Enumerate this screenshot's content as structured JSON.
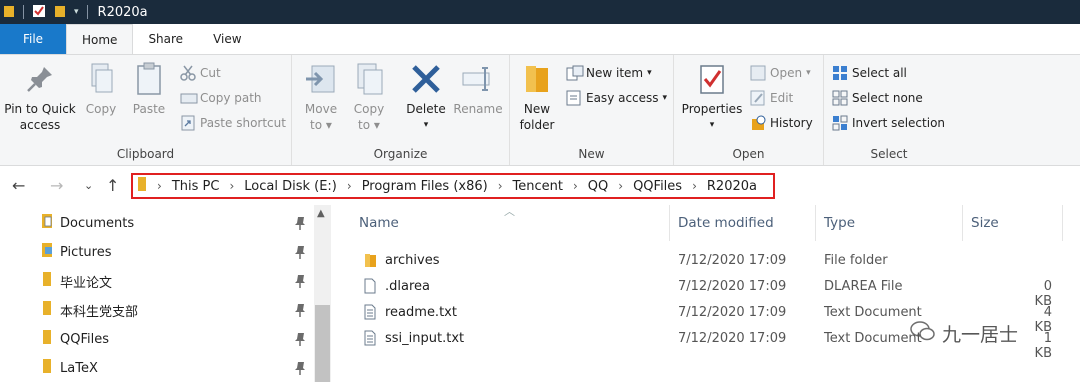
{
  "window": {
    "title": "R2020a"
  },
  "tabs": {
    "file": "File",
    "home": "Home",
    "share": "Share",
    "view": "View"
  },
  "ribbon": {
    "clipboard": {
      "label": "Clipboard",
      "pin_l1": "Pin to Quick",
      "pin_l2": "access",
      "copy": "Copy",
      "paste": "Paste",
      "cut": "Cut",
      "copy_path": "Copy path",
      "paste_shortcut": "Paste shortcut"
    },
    "organize": {
      "label": "Organize",
      "move_l1": "Move",
      "move_l2": "to",
      "copy_l1": "Copy",
      "copy_l2": "to",
      "delete": "Delete",
      "rename": "Rename"
    },
    "new": {
      "label": "New",
      "new_folder_l1": "New",
      "new_folder_l2": "folder",
      "new_item": "New item",
      "easy_access": "Easy access"
    },
    "open": {
      "label": "Open",
      "properties": "Properties",
      "open": "Open",
      "edit": "Edit",
      "history": "History"
    },
    "select": {
      "label": "Select",
      "select_all": "Select all",
      "select_none": "Select none",
      "invert": "Invert selection"
    }
  },
  "address": {
    "crumbs": [
      "This PC",
      "Local Disk (E:)",
      "Program Files (x86)",
      "Tencent",
      "QQ",
      "QQFiles",
      "R2020a"
    ]
  },
  "nav": {
    "items": [
      "Documents",
      "Pictures",
      "毕业论文",
      "本科生党支部",
      "QQFiles",
      "LaTeX"
    ]
  },
  "columns": {
    "name": "Name",
    "date": "Date modified",
    "type": "Type",
    "size": "Size"
  },
  "files": [
    {
      "name": "archives",
      "date": "7/12/2020 17:09",
      "type": "File folder",
      "size": ""
    },
    {
      "name": ".dlarea",
      "date": "7/12/2020 17:09",
      "type": "DLAREA File",
      "size": "0 KB"
    },
    {
      "name": "readme.txt",
      "date": "7/12/2020 17:09",
      "type": "Text Document",
      "size": "4 KB"
    },
    {
      "name": "ssi_input.txt",
      "date": "7/12/2020 17:09",
      "type": "Text Document",
      "size": "1 KB"
    }
  ],
  "watermark": "九一居士",
  "colors": {
    "accent": "#1979ca",
    "address_highlight": "#e02020",
    "folder": "#e8b12a"
  }
}
